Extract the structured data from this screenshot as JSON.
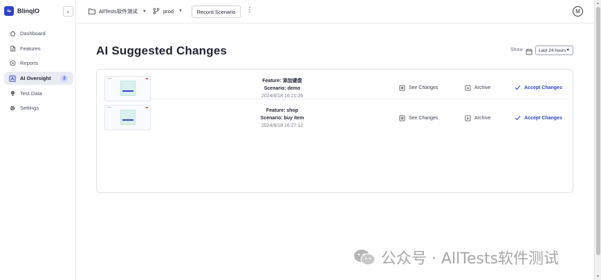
{
  "brand": {
    "name": "BlinqIO",
    "logo_text": "⇋"
  },
  "sidebar": {
    "collapse_glyph": "‹",
    "items": [
      {
        "label": "Dashboard",
        "icon": "home-icon"
      },
      {
        "label": "Features",
        "icon": "file-icon"
      },
      {
        "label": "Reports",
        "icon": "play-circle-icon"
      },
      {
        "label": "AI Oversight",
        "icon": "ai-icon",
        "badge": "2",
        "active": true
      },
      {
        "label": "Test Data",
        "icon": "lightbulb-icon"
      },
      {
        "label": "Settings",
        "icon": "gear-icon"
      }
    ]
  },
  "topbar": {
    "project": "AllTests软件测试",
    "environment": "prod",
    "record_button": "Record Scenario",
    "kebab": "⋮",
    "avatar": "M"
  },
  "main": {
    "title": "AI Suggested Changes",
    "show_label": "Show",
    "time_range": "Last 24 hours"
  },
  "changes": [
    {
      "feature": "Feature: 添加键盘",
      "scenario": "Scenario: demo",
      "time": "2024/8/18 16:21:26",
      "see_changes": "See Changes",
      "archive": "Archive",
      "accept": "Accept Changes"
    },
    {
      "feature": "Feature: shop",
      "scenario": "Scenario: buy item",
      "time": "2024/8/18 16:27:12",
      "see_changes": "See Changes",
      "archive": "Archive",
      "accept": "Accept Changes"
    }
  ],
  "watermark": {
    "text": "公众号 · AllTests软件测试"
  },
  "colors": {
    "accent": "#2f43c9",
    "border": "#dfe2e8",
    "muted": "#7a7f8c"
  }
}
